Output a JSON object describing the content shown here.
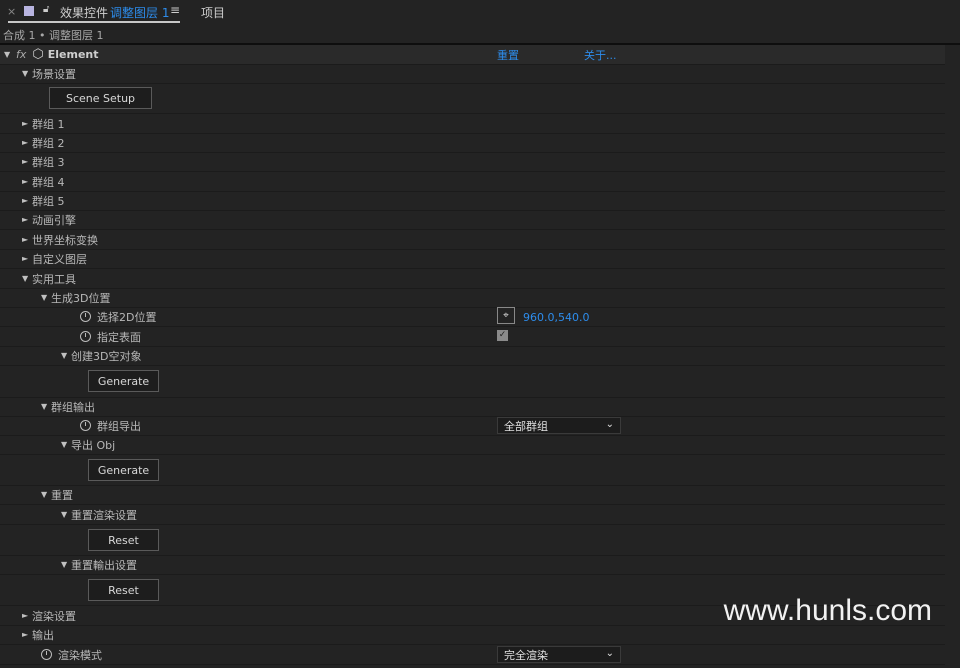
{
  "header": {
    "close": "×",
    "panel_title": "效果控件",
    "layer_name": "调整图层 1",
    "menu": "≡",
    "project_tab": "项目"
  },
  "breadcrumb": "合成 1 • 调整图层 1",
  "effect": {
    "fx": "fx",
    "name": "Element",
    "reset": "重置",
    "about": "关于..."
  },
  "rows": {
    "scene": "场景设置",
    "scene_btn": "Scene Setup",
    "g1": "群组 1",
    "g2": "群组 2",
    "g3": "群组 3",
    "g4": "群组 4",
    "g5": "群组 5",
    "anim": "动画引擎",
    "world": "世界坐标变换",
    "custom": "自定义图层",
    "utility": "实用工具",
    "gen3d": "生成3D位置",
    "pick2d": "选择2D位置",
    "pick2d_value": "960.0,540.0",
    "surface": "指定表面",
    "create3d": "创建3D空对象",
    "generate": "Generate",
    "groupout": "群组输出",
    "groupexport": "群组导出",
    "groupexport_value": "全部群组",
    "exportobj": "导出 Obj",
    "generate2": "Generate",
    "reset": "重置",
    "resetrender": "重置渲染设置",
    "reset_btn": "Reset",
    "resetoutput": "重置輸出设置",
    "reset_btn2": "Reset",
    "render": "渲染设置",
    "output": "输出",
    "rendermode": "渲染模式",
    "rendermode_value": "完全渲染"
  },
  "watermark": "www.hunls.com"
}
